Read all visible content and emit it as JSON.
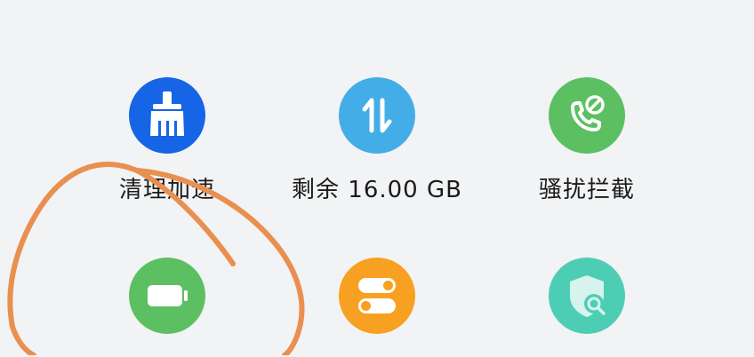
{
  "tiles": [
    {
      "label": "清理加速",
      "icon": "broom-icon",
      "color": "#1565e6"
    },
    {
      "label": "剩余 16.00 GB",
      "icon": "data-transfer-icon",
      "color": "#43ade8"
    },
    {
      "label": "骚扰拦截",
      "icon": "phone-block-icon",
      "color": "#5cbf62"
    },
    {
      "label": "",
      "icon": "battery-icon",
      "color": "#5cbf62"
    },
    {
      "label": "",
      "icon": "toggle-settings-icon",
      "color": "#f8a021"
    },
    {
      "label": "",
      "icon": "shield-search-icon",
      "color": "#4ecdb5"
    }
  ],
  "annotation": {
    "type": "hand-drawn-circle",
    "color": "#e98f4f"
  }
}
